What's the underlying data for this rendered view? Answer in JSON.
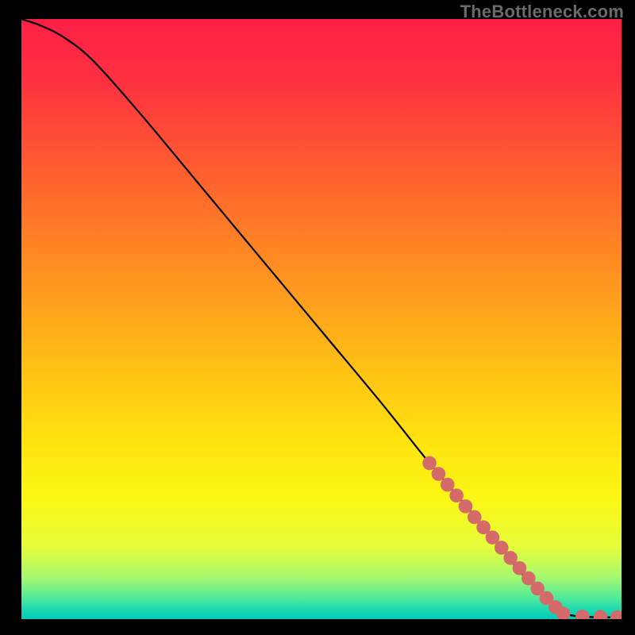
{
  "watermark": "TheBottleneck.com",
  "gradient": {
    "stops": [
      {
        "offset": 0.0,
        "color": "#ff1f47"
      },
      {
        "offset": 0.1,
        "color": "#ff3040"
      },
      {
        "offset": 0.25,
        "color": "#ff5d2f"
      },
      {
        "offset": 0.4,
        "color": "#ff8a22"
      },
      {
        "offset": 0.55,
        "color": "#ffb716"
      },
      {
        "offset": 0.7,
        "color": "#ffe20e"
      },
      {
        "offset": 0.8,
        "color": "#fbf714"
      },
      {
        "offset": 0.88,
        "color": "#e4fc3a"
      },
      {
        "offset": 0.93,
        "color": "#a6f96e"
      },
      {
        "offset": 0.965,
        "color": "#4fe99b"
      },
      {
        "offset": 0.985,
        "color": "#1ad8b1"
      },
      {
        "offset": 1.0,
        "color": "#00c9b9"
      }
    ]
  },
  "chart_data": {
    "type": "line",
    "title": "",
    "xlabel": "",
    "ylabel": "",
    "xlim": [
      0,
      100
    ],
    "ylim": [
      0,
      100
    ],
    "series": [
      {
        "name": "curve",
        "x": [
          0,
          3,
          7,
          12,
          20,
          30,
          40,
          50,
          60,
          68,
          74,
          79,
          83,
          86,
          88.5,
          91,
          94,
          97,
          100
        ],
        "y": [
          100,
          99,
          97,
          93,
          84,
          72,
          60,
          48,
          36,
          26,
          19,
          13,
          8,
          5,
          2.5,
          0.8,
          0.4,
          0.3,
          0.3
        ]
      }
    ],
    "markers": {
      "name": "highlight-dots",
      "color": "#d46a6a",
      "points": [
        {
          "x": 68.0,
          "y": 26.0
        },
        {
          "x": 69.5,
          "y": 24.2
        },
        {
          "x": 71.0,
          "y": 22.4
        },
        {
          "x": 72.5,
          "y": 20.6
        },
        {
          "x": 74.0,
          "y": 18.8
        },
        {
          "x": 75.5,
          "y": 17.0
        },
        {
          "x": 77.0,
          "y": 15.3
        },
        {
          "x": 78.5,
          "y": 13.6
        },
        {
          "x": 80.0,
          "y": 11.9
        },
        {
          "x": 81.5,
          "y": 10.2
        },
        {
          "x": 83.0,
          "y": 8.5
        },
        {
          "x": 84.5,
          "y": 6.8
        },
        {
          "x": 86.0,
          "y": 5.1
        },
        {
          "x": 87.5,
          "y": 3.5
        },
        {
          "x": 89.0,
          "y": 2.0
        },
        {
          "x": 90.3,
          "y": 0.9
        },
        {
          "x": 93.5,
          "y": 0.4
        },
        {
          "x": 96.5,
          "y": 0.35
        },
        {
          "x": 99.3,
          "y": 0.3
        }
      ]
    }
  }
}
